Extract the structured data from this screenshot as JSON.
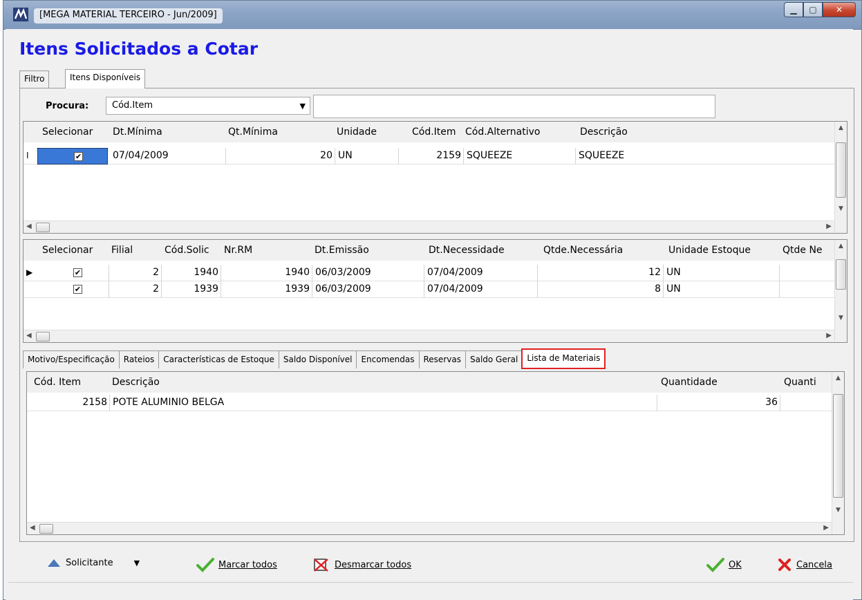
{
  "window": {
    "title": "[MEGA MATERIAL TERCEIRO - Jun/2009]"
  },
  "page": {
    "title": "Itens Solicitados a Cotar"
  },
  "outer_tabs": [
    {
      "label": "Filtro"
    },
    {
      "label": "Itens Disponíveis",
      "active": true
    }
  ],
  "search": {
    "label": "Procura:",
    "field_selected": "Cód.Item",
    "value": ""
  },
  "items_grid": {
    "columns": [
      "Selecionar",
      "Dt.Mínima",
      "Qt.Mínima",
      "Unidade",
      "Cód.Item",
      "Cód.Alternativo",
      "Descrição"
    ],
    "rows": [
      {
        "indicator": "I",
        "selected": "✔",
        "dt_minima": "07/04/2009",
        "qt_minima": "20",
        "unidade": "UN",
        "cod_item": "2159",
        "cod_alternativo": "SQUEEZE",
        "descricao": "SQUEEZE"
      }
    ]
  },
  "requests_grid": {
    "columns": [
      "Selecionar",
      "Filial",
      "Cód.Solic",
      "Nr.RM",
      "Dt.Emissão",
      "Dt.Necessidade",
      "Qtde.Necessária",
      "Unidade Estoque",
      "Qtde Ne"
    ],
    "rows": [
      {
        "indicator": "▶",
        "selected": "✔",
        "filial": "2",
        "cod_solic": "1940",
        "nr_rm": "1940",
        "dt_emissao": "06/03/2009",
        "dt_necessidade": "07/04/2009",
        "qtde_necessaria": "12",
        "unidade_estoque": "UN"
      },
      {
        "indicator": "",
        "selected": "✔",
        "filial": "2",
        "cod_solic": "1939",
        "nr_rm": "1939",
        "dt_emissao": "06/03/2009",
        "dt_necessidade": "07/04/2009",
        "qtde_necessaria": "8",
        "unidade_estoque": "UN"
      }
    ]
  },
  "inner_tabs": [
    {
      "label": "Motivo/Especificação"
    },
    {
      "label": "Rateios"
    },
    {
      "label": "Características de Estoque"
    },
    {
      "label": "Saldo Disponível"
    },
    {
      "label": "Encomendas"
    },
    {
      "label": "Reservas"
    },
    {
      "label": "Saldo Geral"
    },
    {
      "label": "Lista de Materiais",
      "active": true
    }
  ],
  "materials_grid": {
    "columns": [
      "Cód. Item",
      "Descrição",
      "Quantidade",
      "Quanti"
    ],
    "rows": [
      {
        "cod_item": "2158",
        "descricao": "POTE ALUMINIO BELGA",
        "quantidade": "36"
      }
    ]
  },
  "toolbar": {
    "solicitante": "Solicitante",
    "marcar_todos": "Marcar todos",
    "desmarcar_todos": "Desmarcar todos",
    "ok": "OK",
    "cancela": "Cancela"
  },
  "colors": {
    "title_blue": "#1a1ae6",
    "selection_blue": "#3a78d8",
    "highlight_red": "#e02020",
    "check_green": "#4cb030"
  }
}
